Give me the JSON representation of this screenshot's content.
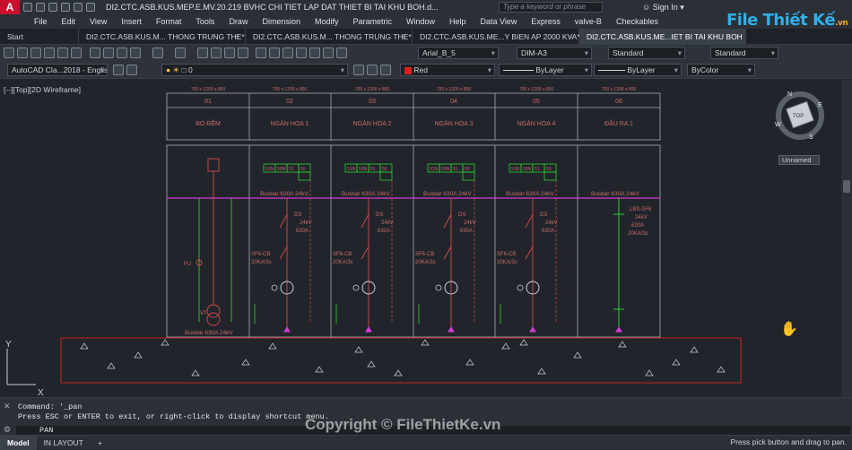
{
  "app": {
    "logo": "A",
    "title": "DI2.CTC.ASB.KUS.MEP.E.MV.20.219 BVHC CHI TIET LAP DAT THIET BI TAI KHU BOH.d...",
    "search_placeholder": "Type a keyword or phrase",
    "sign_in": "Sign In"
  },
  "brand": {
    "name": "File Thiết Kế",
    "sub": ".vn"
  },
  "menu": [
    "File",
    "Edit",
    "View",
    "Insert",
    "Format",
    "Tools",
    "Draw",
    "Dimension",
    "Modify",
    "Parametric",
    "Window",
    "Help",
    "Data View",
    "Express",
    "valve-B",
    "Checkables"
  ],
  "tabs": [
    {
      "label": "Start"
    },
    {
      "label": "DI2.CTC.ASB.KUS.M... THONG TRUNG THE*"
    },
    {
      "label": "DI2.CTC.ASB.KUS.M... THONG TRUNG THE*"
    },
    {
      "label": "DI2.CTC.ASB.KUS.ME...Y BIEN AP 2000 KVA*"
    },
    {
      "label": "DI2.CTC.ASB.KUS.ME...IET BI TAI KHU BOH"
    }
  ],
  "toolbar": {
    "text_style": "Arial_B_5",
    "dim_style": "DIM-A3",
    "table_style": "Standard",
    "multileader_style": "Standard",
    "workspace": "AutoCAD Cla...2018 - English",
    "layer": "0",
    "color": "Red",
    "linetype": "ByLayer",
    "lineweight": "ByLayer",
    "plotstyle": "ByColor",
    "colors": {
      "red_swatch": "#e02020"
    }
  },
  "viewport": {
    "label": "[--][Top][2D Wireframe]",
    "named_view": "Unnamed",
    "viewcube": {
      "top": "TOP",
      "n": "N",
      "s": "S",
      "e": "E",
      "w": "W"
    },
    "ucs": {
      "x": "X",
      "y": "Y"
    }
  },
  "drawing": {
    "panels": [
      {
        "no": "01",
        "name": "BO ĐẾM",
        "size": "700 x 1200 x 800"
      },
      {
        "no": "02",
        "name": "NGĂN HÒA 1",
        "size": "700 x 1200 x 800"
      },
      {
        "no": "03",
        "name": "NGĂN HÒA 2",
        "size": "700 x 1200 x 800"
      },
      {
        "no": "04",
        "name": "NGĂN HÒA 3",
        "size": "700 x 1200 x 800"
      },
      {
        "no": "05",
        "name": "NGĂN HÒA 4",
        "size": "700 x 1200 x 800"
      },
      {
        "no": "06",
        "name": "ĐẦU RA 1",
        "size": "700 x 1200 x 800"
      }
    ],
    "busbar": "Busbar 630A 24kV",
    "busbar_bottom": "Busbar 630A 24kV",
    "panel_device": {
      "ds": "DS",
      "kv": "24kV",
      "amp": "630A",
      "sf6": "SF6-CB",
      "ka": "20KA/3s"
    },
    "out_device": {
      "name": "LBS-SF6",
      "kv": "24kV",
      "amp": "630A",
      "ka": "20KA/3s"
    },
    "meter_labels": {
      "fu": "FU",
      "vt": "VT"
    },
    "box_labels": [
      "51N",
      "50N",
      "51",
      "50"
    ],
    "colors": {
      "red": "#d64a4a",
      "green": "#2fd02f",
      "magenta": "#d63ad6",
      "grey": "#a6adb6"
    }
  },
  "command": {
    "history": "Command: '_pan",
    "hint": "Press ESC or ENTER to exit, or right-click to display shortcut menu.",
    "current": "PAN"
  },
  "status": {
    "tabs": [
      "Model",
      "IN LAYOUT"
    ],
    "hint": "Press pick button and drag to pan."
  },
  "watermark": "Copyright © FileThietKe.vn"
}
